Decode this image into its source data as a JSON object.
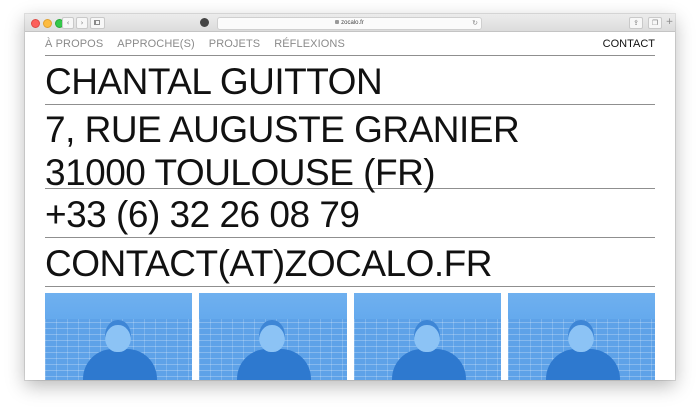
{
  "browser": {
    "url": "zocalo.fr"
  },
  "nav": {
    "items": [
      "À PROPOS",
      "APPROCHE(S)",
      "PROJETS",
      "RÉFLEXIONS"
    ],
    "contact": "CONTACT"
  },
  "contact_info": {
    "name": "CHANTAL GUITTON",
    "address_line1": "7, RUE AUGUSTE GRANIER",
    "address_line2": "31000 TOULOUSE (FR)",
    "phone": "+33 (6) 32 26 08 79",
    "email": "CONTACT(AT)ZOCALO.FR"
  },
  "photos": {
    "count": 4,
    "tint": "#5fa6ec"
  },
  "colors": {
    "text": "#111111",
    "nav_inactive": "#8a8a8a",
    "rule": "#8f8f8f"
  }
}
